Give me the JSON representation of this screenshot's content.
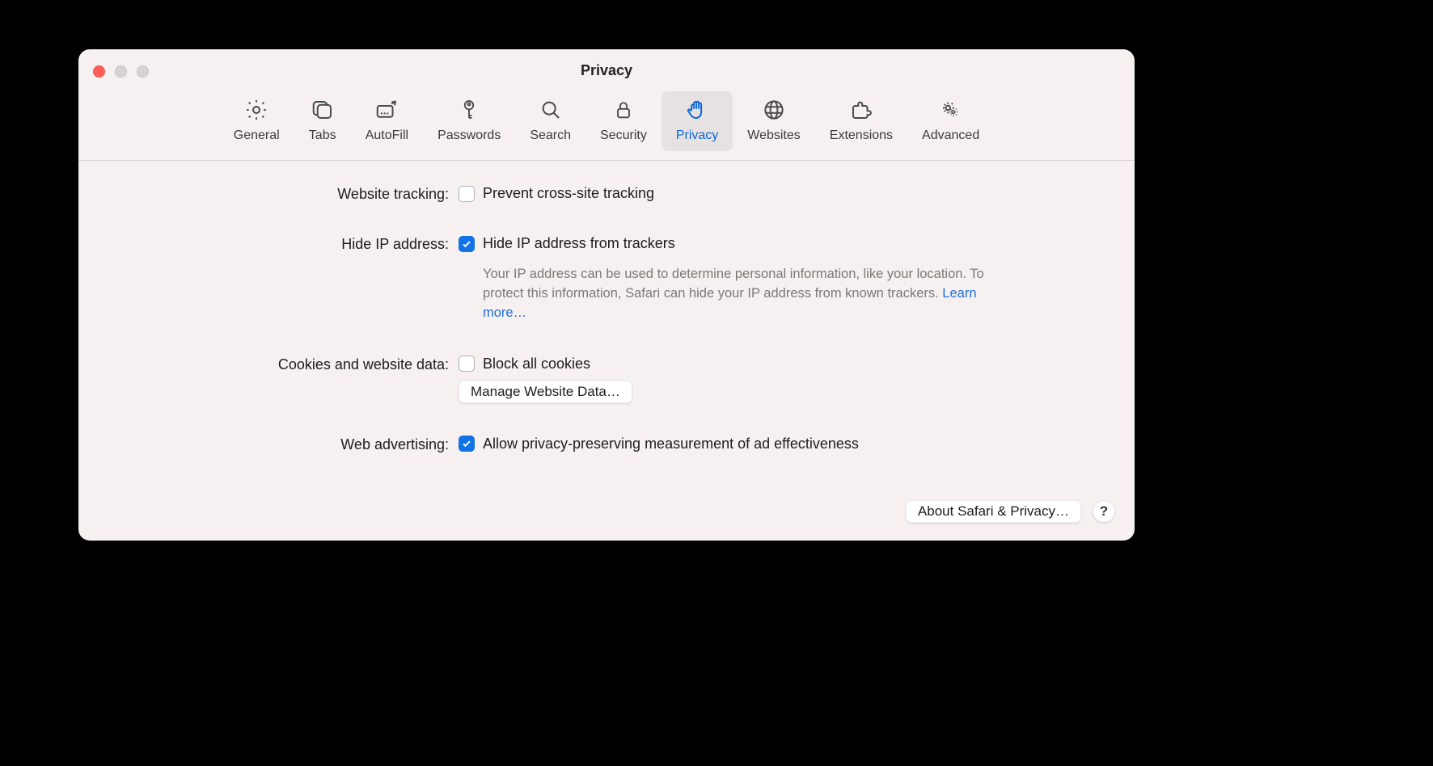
{
  "window": {
    "title": "Privacy"
  },
  "toolbar": {
    "items": [
      {
        "label": "General"
      },
      {
        "label": "Tabs"
      },
      {
        "label": "AutoFill"
      },
      {
        "label": "Passwords"
      },
      {
        "label": "Search"
      },
      {
        "label": "Security"
      },
      {
        "label": "Privacy"
      },
      {
        "label": "Websites"
      },
      {
        "label": "Extensions"
      },
      {
        "label": "Advanced"
      }
    ],
    "active_index": 6
  },
  "settings": {
    "website_tracking": {
      "label": "Website tracking:",
      "option": "Prevent cross-site tracking",
      "checked": false
    },
    "hide_ip": {
      "label": "Hide IP address:",
      "option": "Hide IP address from trackers",
      "checked": true,
      "description": "Your IP address can be used to determine personal information, like your location. To protect this information, Safari can hide your IP address from known trackers. ",
      "learn_more": "Learn more…"
    },
    "cookies": {
      "label": "Cookies and website data:",
      "option": "Block all cookies",
      "checked": false,
      "manage_button": "Manage Website Data…"
    },
    "web_advertising": {
      "label": "Web advertising:",
      "option": "Allow privacy-preserving measurement of ad effectiveness",
      "checked": true
    }
  },
  "footer": {
    "about_button": "About Safari & Privacy…",
    "help": "?"
  }
}
